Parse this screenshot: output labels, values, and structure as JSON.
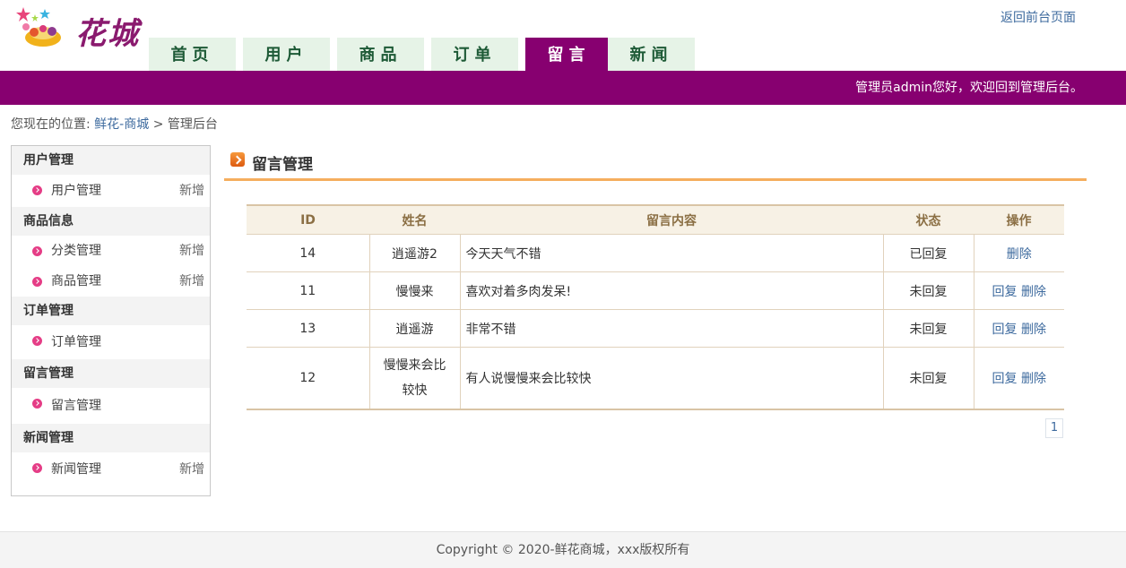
{
  "header": {
    "logo_text": "花城",
    "back_link": "返回前台页面",
    "nav": [
      {
        "label": "首页",
        "active": false
      },
      {
        "label": "用户",
        "active": false
      },
      {
        "label": "商品",
        "active": false
      },
      {
        "label": "订单",
        "active": false
      },
      {
        "label": "留言",
        "active": true
      },
      {
        "label": "新闻",
        "active": false
      }
    ],
    "welcome": "管理员admin您好，欢迎回到管理后台。",
    "brand_color": "#870070"
  },
  "breadcrumb": {
    "prefix": "您现在的位置:",
    "link": "鲜花-商城",
    "separator": ">",
    "current": "管理后台"
  },
  "sidebar": {
    "groups": [
      {
        "title": "用户管理",
        "items": [
          {
            "label": "用户管理",
            "add": "新增"
          }
        ]
      },
      {
        "title": "商品信息",
        "items": [
          {
            "label": "分类管理",
            "add": "新增"
          },
          {
            "label": "商品管理",
            "add": "新增"
          }
        ]
      },
      {
        "title": "订单管理",
        "items": [
          {
            "label": "订单管理",
            "add": ""
          }
        ]
      },
      {
        "title": "留言管理",
        "items": [
          {
            "label": "留言管理",
            "add": ""
          }
        ]
      },
      {
        "title": "新闻管理",
        "items": [
          {
            "label": "新闻管理",
            "add": "新增"
          }
        ]
      }
    ]
  },
  "main": {
    "title": "留言管理",
    "table": {
      "headers": [
        "ID",
        "姓名",
        "留言内容",
        "状态",
        "操作"
      ],
      "rows": [
        {
          "id": "14",
          "name": "逍遥游2",
          "content": "今天天气不错",
          "status": "已回复",
          "actions": [
            "删除"
          ]
        },
        {
          "id": "11",
          "name": "慢慢来",
          "content": "喜欢对着多肉发呆!",
          "status": "未回复",
          "actions": [
            "回复",
            "删除"
          ]
        },
        {
          "id": "13",
          "name": "逍遥游",
          "content": "非常不错",
          "status": "未回复",
          "actions": [
            "回复",
            "删除"
          ]
        },
        {
          "id": "12",
          "name": "慢慢来会比较快",
          "content": "有人说慢慢来会比较快",
          "status": "未回复",
          "actions": [
            "回复",
            "删除"
          ]
        }
      ]
    },
    "pager": [
      "1"
    ]
  },
  "footer": {
    "text": "Copyright © 2020-鲜花商城，xxx版权所有"
  }
}
